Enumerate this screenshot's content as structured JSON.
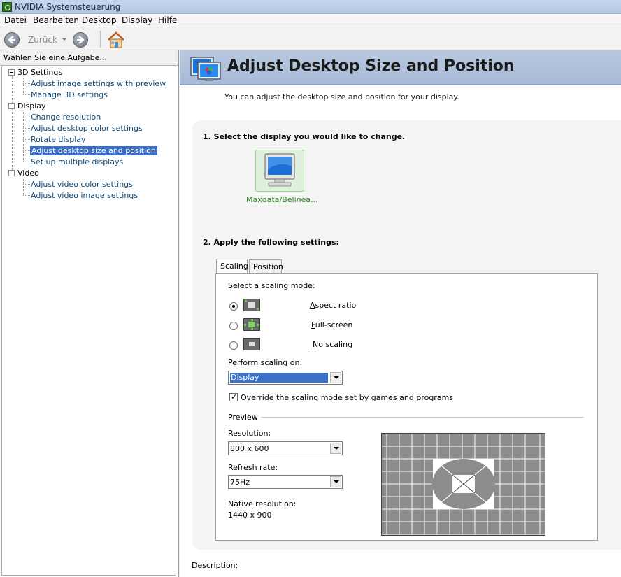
{
  "window": {
    "title": "NVIDIA Systemsteuerung"
  },
  "menu": [
    "Datei",
    "Bearbeiten",
    "Desktop",
    "Display",
    "Hilfe"
  ],
  "toolbar": {
    "back_label": "Zurück"
  },
  "sidebar": {
    "header": "Wählen Sie eine Aufgabe...",
    "categories": [
      {
        "label": "3D Settings",
        "items": [
          "Adjust image settings with preview",
          "Manage 3D settings"
        ]
      },
      {
        "label": "Display",
        "items": [
          "Change resolution",
          "Adjust desktop color settings",
          "Rotate display",
          "Adjust desktop size and position",
          "Set up multiple displays"
        ]
      },
      {
        "label": "Video",
        "items": [
          "Adjust video color settings",
          "Adjust video image settings"
        ]
      }
    ],
    "selected": "Adjust desktop size and position"
  },
  "page": {
    "title": "Adjust Desktop Size and Position",
    "subtitle": "You can adjust the desktop size and position for your display.",
    "step1": "1. Select the display you would like to change.",
    "display_name": "Maxdata/Belinea...",
    "step2": "2. Apply the following settings:",
    "tabs": [
      "Scaling",
      "Position"
    ],
    "active_tab": "Scaling",
    "scaling_mode_label": "Select a scaling mode:",
    "scaling_modes": [
      {
        "label_prefix": "",
        "label_accel": "A",
        "label_rest": "spect ratio",
        "selected": true
      },
      {
        "label_prefix": "",
        "label_accel": "F",
        "label_rest": "ull-screen",
        "selected": false
      },
      {
        "label_prefix": "",
        "label_accel": "N",
        "label_rest": "o scaling",
        "selected": false
      }
    ],
    "perform_on_label": "Perform scaling on:",
    "perform_on_value": "Display",
    "override_label": "Override the scaling mode set by games and programs",
    "override_checked": true,
    "preview_label": "Preview",
    "resolution_label": "Resolution:",
    "resolution_value": "800 x 600",
    "refresh_label": "Refresh rate:",
    "refresh_value": "75Hz",
    "native_label": "Native resolution:",
    "native_value": "1440 x 900",
    "description_label": "Description:"
  },
  "colors": {
    "link": "#0e4a7b",
    "selection": "#3a70c8",
    "banner": "#b8c8df",
    "display_label": "#2d8a24"
  }
}
